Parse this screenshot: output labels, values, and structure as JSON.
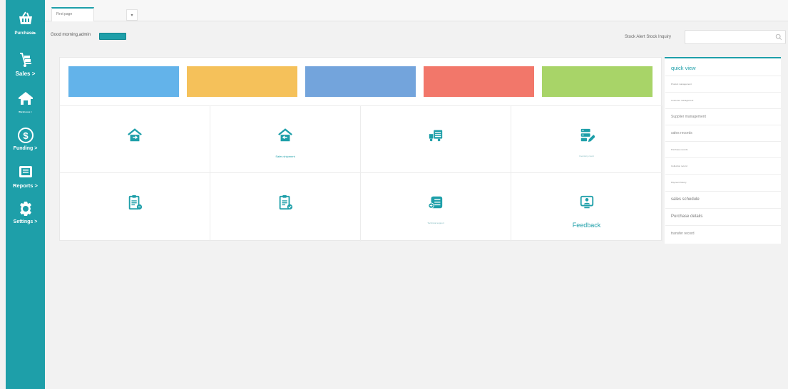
{
  "sidebar": {
    "items": [
      {
        "label": "Purchase▸",
        "icon": "shopping-basket-icon"
      },
      {
        "label": "Sales >",
        "icon": "hand-truck-icon"
      },
      {
        "label": "Warehouse >",
        "icon": "warehouse-icon"
      },
      {
        "label": "Funding >",
        "icon": "dollar-circle-icon"
      },
      {
        "label": "Reports >",
        "icon": "report-icon"
      },
      {
        "label": "Settings >",
        "icon": "gear-icon"
      }
    ]
  },
  "tabs": [
    {
      "label": "First page"
    }
  ],
  "tab_dropdown_glyph": "▾",
  "header": {
    "greeting": "Good morning,admin",
    "stock_alert": "Stock Alert Stock Inquiry",
    "search_value": ""
  },
  "banners": [
    {
      "color": "#63b3ea"
    },
    {
      "color": "#f5c15a"
    },
    {
      "color": "#73a4dc"
    },
    {
      "color": "#f2776a"
    },
    {
      "color": "#a8d468"
    }
  ],
  "tiles": [
    {
      "label": "",
      "icon": "home-out-icon"
    },
    {
      "label": "Sales shipment",
      "icon": "home-in-icon"
    },
    {
      "label": "",
      "icon": "delivery-truck-icon"
    },
    {
      "label": "Inventory count",
      "icon": "server-edit-icon"
    },
    {
      "label": "",
      "icon": "clipboard-arrow-icon"
    },
    {
      "label": "",
      "icon": "clipboard-check-icon"
    },
    {
      "label": "Technical support",
      "icon": "drive-add-icon"
    },
    {
      "label": "Feedback",
      "icon": "monitor-user-icon"
    }
  ],
  "quickview": {
    "title": "quick view",
    "items": [
      {
        "label": "Product management"
      },
      {
        "label": "Customer management"
      },
      {
        "label": "Supplier management"
      },
      {
        "label": "sales records"
      },
      {
        "label": "Purchase records"
      },
      {
        "label": "Collection record"
      },
      {
        "label": "Payment history"
      },
      {
        "label": "sales schedule"
      },
      {
        "label": "Purchase details"
      },
      {
        "label": "transfer record"
      }
    ]
  },
  "colors": {
    "accent": "#1e9fa9",
    "sidebar": "#1e9fa9",
    "background": "#f2f2f2"
  }
}
